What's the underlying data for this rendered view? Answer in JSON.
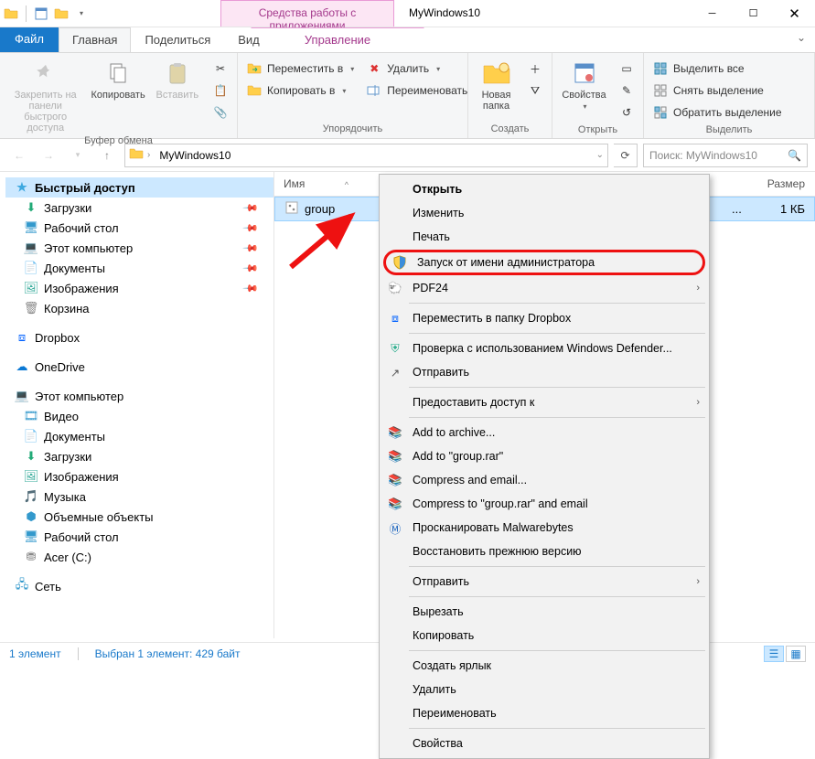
{
  "window": {
    "title": "MyWindows10",
    "contextual_tab_group": "Средства работы с приложениями",
    "contextual_tab": "Управление"
  },
  "tabs": {
    "file": "Файл",
    "home": "Главная",
    "share": "Поделиться",
    "view": "Вид"
  },
  "ribbon": {
    "clipboard": {
      "pin": "Закрепить на панели\nбыстрого доступа",
      "copy": "Копировать",
      "paste": "Вставить",
      "label": "Буфер обмена"
    },
    "organize": {
      "move_to": "Переместить в",
      "copy_to": "Копировать в",
      "delete": "Удалить",
      "rename": "Переименовать",
      "label": "Упорядочить"
    },
    "new": {
      "new_folder": "Новая\nпапка",
      "label": "Создать"
    },
    "open": {
      "properties": "Свойства",
      "label": "Открыть"
    },
    "select": {
      "select_all": "Выделить все",
      "select_none": "Снять выделение",
      "invert": "Обратить выделение",
      "label": "Выделить"
    }
  },
  "address": {
    "crumb1": "MyWindows10"
  },
  "search": {
    "placeholder": "Поиск: MyWindows10"
  },
  "nav": {
    "quick_access": "Быстрый доступ",
    "downloads": "Загрузки",
    "desktop": "Рабочий стол",
    "this_pc_q": "Этот компьютер",
    "documents": "Документы",
    "pictures": "Изображения",
    "recycle": "Корзина",
    "dropbox": "Dropbox",
    "onedrive": "OneDrive",
    "this_pc": "Этот компьютер",
    "videos": "Видео",
    "documents2": "Документы",
    "downloads2": "Загрузки",
    "pictures2": "Изображения",
    "music": "Музыка",
    "objects3d": "Объемные объекты",
    "desktop2": "Рабочий стол",
    "acer_c": "Acer (C:)",
    "network": "Сеть"
  },
  "list": {
    "col_name": "Имя",
    "col_size": "Размер",
    "file_name": "group",
    "file_size": "1 КБ",
    "dots": "..."
  },
  "ctx": {
    "open": "Открыть",
    "edit": "Изменить",
    "print": "Печать",
    "run_as_admin": "Запуск от имени администратора",
    "pdf24": "PDF24",
    "move_dropbox": "Переместить в папку Dropbox",
    "defender": "Проверка с использованием Windows Defender...",
    "share": "Отправить",
    "grant_access": "Предоставить доступ к",
    "add_archive": "Add to archive...",
    "add_group_rar": "Add to \"group.rar\"",
    "compress_email": "Compress and email...",
    "compress_group_email": "Compress to \"group.rar\" and email",
    "malwarebytes": "Просканировать Malwarebytes",
    "prev_versions": "Восстановить прежнюю версию",
    "send_to": "Отправить",
    "cut": "Вырезать",
    "copy": "Копировать",
    "shortcut": "Создать ярлык",
    "delete": "Удалить",
    "rename": "Переименовать",
    "properties": "Свойства"
  },
  "status": {
    "count": "1 элемент",
    "selection": "Выбран 1 элемент: 429 байт"
  }
}
